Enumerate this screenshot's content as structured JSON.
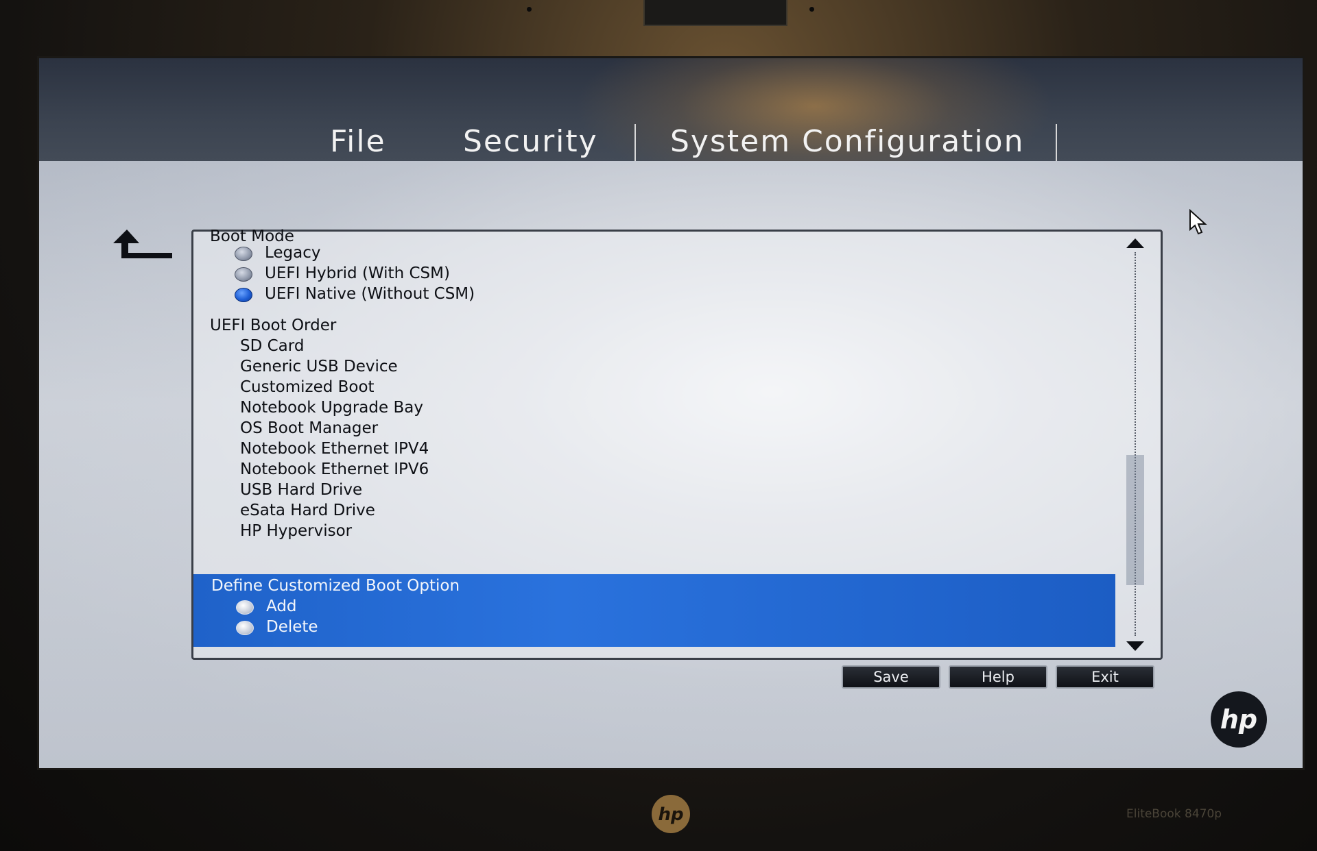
{
  "menu": {
    "file": "File",
    "security": "Security",
    "system_configuration": "System Configuration"
  },
  "boot_mode": {
    "heading": "Boot Mode",
    "options": [
      {
        "label": "Legacy",
        "selected": false
      },
      {
        "label": "UEFI Hybrid (With CSM)",
        "selected": false
      },
      {
        "label": "UEFI Native (Without CSM)",
        "selected": true
      }
    ]
  },
  "uefi_boot_order": {
    "heading": "UEFI Boot Order",
    "items": [
      "SD Card",
      "Generic USB Device",
      "Customized Boot",
      "Notebook Upgrade Bay",
      "OS Boot Manager",
      "Notebook Ethernet IPV4",
      "Notebook Ethernet IPV6",
      "USB Hard Drive",
      "eSata Hard Drive",
      "HP Hypervisor"
    ]
  },
  "custom_boot": {
    "heading": "Define Customized Boot Option",
    "options": [
      {
        "label": "Add",
        "selected": false
      },
      {
        "label": "Delete",
        "selected": false
      }
    ]
  },
  "buttons": {
    "save": "Save",
    "help": "Help",
    "exit": "Exit"
  },
  "branding": {
    "logo": "hp",
    "model": "EliteBook 8470p"
  },
  "colors": {
    "highlight": "#1f62c9",
    "radio_selected": "#1f5fd6",
    "header": "#3b4350"
  }
}
